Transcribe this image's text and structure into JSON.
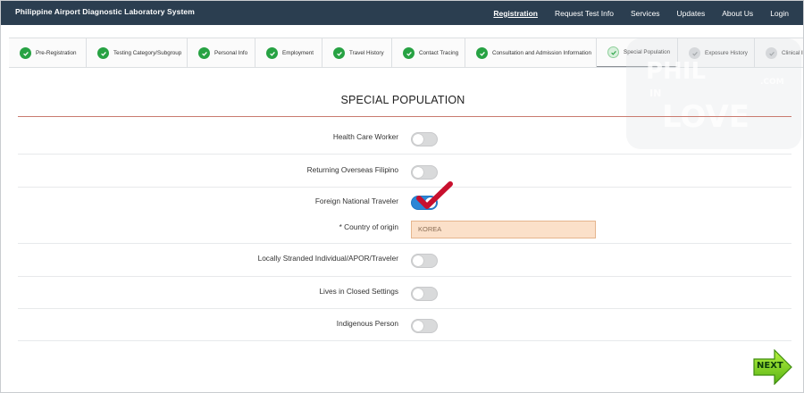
{
  "app": {
    "title": "Philippine Airport Diagnostic Laboratory System"
  },
  "nav": [
    {
      "label": "Registration",
      "active": true
    },
    {
      "label": "Request Test Info"
    },
    {
      "label": "Services"
    },
    {
      "label": "Updates"
    },
    {
      "label": "About Us"
    },
    {
      "label": "Login"
    }
  ],
  "steps": [
    {
      "label": "Pre-Registration",
      "status": "done"
    },
    {
      "label": "Testing Category/Subgroup",
      "status": "done"
    },
    {
      "label": "Personal Info",
      "status": "done"
    },
    {
      "label": "Employment",
      "status": "done"
    },
    {
      "label": "Travel History",
      "status": "done"
    },
    {
      "label": "Contact Tracing",
      "status": "done"
    },
    {
      "label": "Consultation and Admission Information",
      "status": "done"
    },
    {
      "label": "Special Population",
      "status": "current"
    },
    {
      "label": "Exposure History",
      "status": "pending"
    },
    {
      "label": "Clinical I",
      "status": "pending"
    }
  ],
  "section": {
    "title": "SPECIAL POPULATION"
  },
  "form": {
    "health_care_worker": {
      "label": "Health Care Worker",
      "on": false
    },
    "returning_ofw": {
      "label": "Returning Overseas Filipino",
      "on": false
    },
    "foreign_national": {
      "label": "Foreign National Traveler",
      "on": true
    },
    "country_of_origin": {
      "label": "* Country of origin",
      "value": "KOREA"
    },
    "locally_stranded": {
      "label": "Locally Stranded Individual/APOR/Traveler",
      "on": false
    },
    "closed_settings": {
      "label": "Lives in Closed Settings",
      "on": false
    },
    "indigenous": {
      "label": "Indigenous Person",
      "on": false
    }
  },
  "watermark": {
    "line1": "PHIL",
    "line2": "IN",
    "line3": "LOVE",
    "suffix": ".COM"
  },
  "next_button": {
    "label": "NEXT"
  },
  "colors": {
    "navbar": "#2b3e50",
    "done": "#27a243",
    "toggle_on": "#2c86d6",
    "input_bg": "#fbe0c9"
  }
}
